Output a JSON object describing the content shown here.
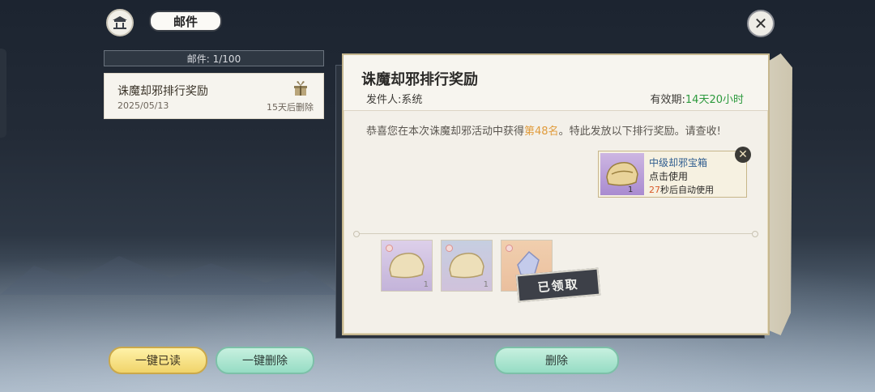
{
  "header": {
    "title": "邮件",
    "home_icon": "pavilion-icon",
    "close_icon": "close-icon"
  },
  "mail_list": {
    "count_label": "邮件: 1/100",
    "items": [
      {
        "subject": "诛魔却邪排行奖励",
        "date": "2025/05/13",
        "expire": "15天后删除",
        "icon": "gift-icon"
      }
    ]
  },
  "mail_detail": {
    "title": "诛魔却邪排行奖励",
    "sender": "发件人:系统",
    "validity_label": "有效期:",
    "validity_value": "14天20小时",
    "body_before": "恭喜您在本次诛魔却邪活动中获得",
    "body_rank": "第48名",
    "body_after": "。特此发放以下排行奖励。请查收!",
    "item_tip": {
      "name": "中级却邪宝箱",
      "use": "点击使用",
      "auto_num": "27",
      "auto_text": "秒后自动使用",
      "qty": "1"
    },
    "rewards": [
      {
        "qty": "1",
        "icon": "treasure-chest-icon"
      },
      {
        "qty": "1",
        "icon": "treasure-chest-icon"
      },
      {
        "qty": "",
        "icon": "crystal-icon"
      }
    ],
    "claimed_label": "已领取"
  },
  "footer": {
    "read_all": "一键已读",
    "delete_all": "一键删除",
    "delete": "删除"
  },
  "colors": {
    "accent_green": "#2d9a3e",
    "rank_orange": "#e09b3b",
    "panel_bg": "#f3f0e9"
  }
}
